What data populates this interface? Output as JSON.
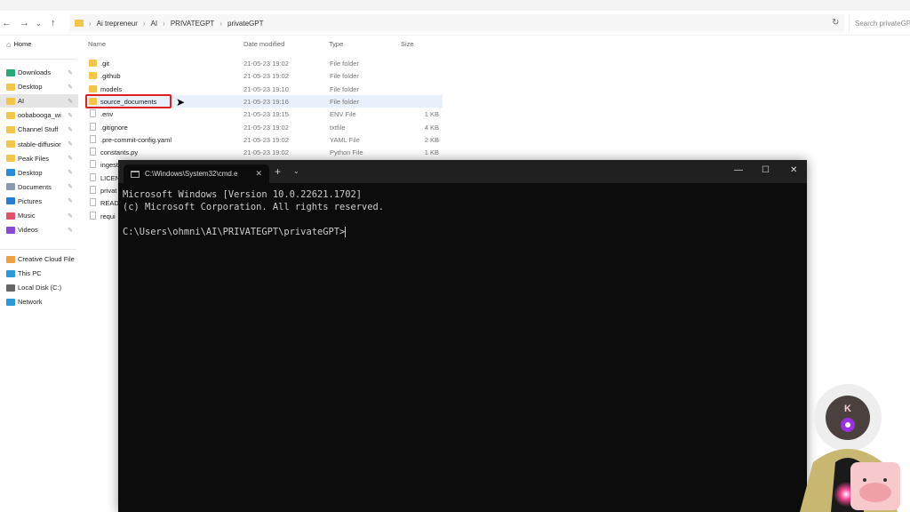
{
  "explorer": {
    "breadcrumb": [
      "Ai trepreneur",
      "AI",
      "PRIVATEGPT",
      "privateGPT"
    ],
    "search_placeholder": "Search privateGPT",
    "columns": {
      "name": "Name",
      "date": "Date modified",
      "type": "Type",
      "size": "Size"
    },
    "sidebar": {
      "home": "Home",
      "quick": [
        {
          "label": "Downloads",
          "color": "#2aa876"
        },
        {
          "label": "Desktop",
          "color": "#f5c54a"
        },
        {
          "label": "AI",
          "color": "#f5c54a"
        },
        {
          "label": "oobabooga_wi",
          "color": "#f5c54a"
        },
        {
          "label": "Channel Stuff",
          "color": "#f5c54a"
        },
        {
          "label": "stable-diffusior",
          "color": "#f5c54a"
        },
        {
          "label": "Peak Files",
          "color": "#f5c54a"
        },
        {
          "label": "Desktop",
          "color": "#2a8bd8"
        },
        {
          "label": "Documents",
          "color": "#8a9bb0"
        },
        {
          "label": "Pictures",
          "color": "#2a7bd8"
        },
        {
          "label": "Music",
          "color": "#e0506a"
        },
        {
          "label": "Videos",
          "color": "#8a4ad8"
        }
      ],
      "other": [
        {
          "label": "Creative Cloud File",
          "color": "#f0a040"
        },
        {
          "label": "This PC",
          "color": "#2a9bd8"
        },
        {
          "label": "Local Disk (C:)",
          "color": "#666"
        },
        {
          "label": "Network",
          "color": "#2a9bd8"
        }
      ]
    },
    "files": [
      {
        "name": ".git",
        "date": "21-05-23 19:02",
        "type": "File folder",
        "size": "",
        "kind": "folder"
      },
      {
        "name": ".github",
        "date": "21-05-23 19:02",
        "type": "File folder",
        "size": "",
        "kind": "folder"
      },
      {
        "name": "models",
        "date": "21-05-23 19:10",
        "type": "File folder",
        "size": "",
        "kind": "folder"
      },
      {
        "name": "source_documents",
        "date": "21-05-23 19:16",
        "type": "File folder",
        "size": "",
        "kind": "folder"
      },
      {
        "name": ".env",
        "date": "21-05-23 19:15",
        "type": "ENV File",
        "size": "1 KB",
        "kind": "file"
      },
      {
        "name": ".gitignore",
        "date": "21-05-23 19:02",
        "type": "txtfile",
        "size": "4 KB",
        "kind": "file"
      },
      {
        "name": ".pre-commit-config.yaml",
        "date": "21-05-23 19:02",
        "type": "YAML File",
        "size": "2 KB",
        "kind": "file"
      },
      {
        "name": "constants.py",
        "date": "21-05-23 19:02",
        "type": "Python File",
        "size": "1 KB",
        "kind": "file"
      },
      {
        "name": "ingest",
        "date": "",
        "type": "",
        "size": "",
        "kind": "file"
      },
      {
        "name": "LICEN",
        "date": "",
        "type": "",
        "size": "",
        "kind": "file"
      },
      {
        "name": "privat",
        "date": "",
        "type": "",
        "size": "",
        "kind": "file"
      },
      {
        "name": "READ",
        "date": "",
        "type": "",
        "size": "",
        "kind": "file"
      },
      {
        "name": "requi",
        "date": "",
        "type": "",
        "size": "",
        "kind": "file"
      }
    ]
  },
  "terminal": {
    "tab_title": "C:\\Windows\\System32\\cmd.e",
    "lines": [
      "Microsoft Windows [Version 10.0.22621.1702]",
      "(c) Microsoft Corporation. All rights reserved.",
      "",
      "C:\\Users\\ohmni\\AI\\PRIVATEGPT\\privateGPT>"
    ]
  },
  "overlay": {
    "avatar_letter": "K"
  }
}
